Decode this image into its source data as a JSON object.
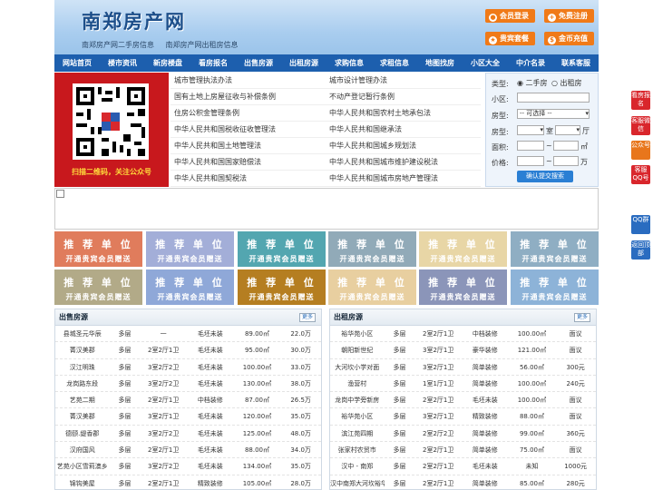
{
  "header": {
    "logo": "南郑房产网",
    "subtitle": [
      "南郑房产网二手房信息",
      "南郑房产网出租房信息"
    ],
    "buttons": [
      {
        "label": "会员登录",
        "icon": "user-icon"
      },
      {
        "label": "免费注册",
        "icon": "register-icon"
      },
      {
        "label": "贵宾套餐",
        "icon": "vip-icon"
      },
      {
        "label": "金币充值",
        "icon": "coin-icon"
      }
    ]
  },
  "nav": [
    "网站首页",
    "楼市资讯",
    "新房楼盘",
    "看房报名",
    "出售房源",
    "出租房源",
    "求购信息",
    "求租信息",
    "地图找房",
    "小区大全",
    "中介名录",
    "联系客服"
  ],
  "qr": {
    "caption": "扫描二维码，关注公众号"
  },
  "laws": [
    [
      "城市管理执法办法",
      "城市设计管理办法"
    ],
    [
      "国有土地上房屋征收与补偿条例",
      "不动产登记暂行条例"
    ],
    [
      "住房公积金管理条例",
      "中华人民共和国农村土地承包法"
    ],
    [
      "中华人民共和国税收征收管理法",
      "中华人民共和国继承法"
    ],
    [
      "中华人民共和国土地管理法",
      "中华人民共和国城乡规划法"
    ],
    [
      "中华人民共和国国家赔偿法",
      "中华人民共和国城市维护建设税法"
    ],
    [
      "中华人民共和国契税法",
      "中华人民共和国城市房地产管理法"
    ]
  ],
  "search": {
    "type_label": "类型:",
    "opt_sale": "二手房",
    "opt_rent": "出租房",
    "community_label": "小区:",
    "room_label": "房型:",
    "room_select": "-- 可选择 --",
    "shi": "室",
    "ting": "厅",
    "area_label": "面积:",
    "area_unit": "㎡",
    "price_label": "价格:",
    "price_unit": "万",
    "tilde": "~",
    "submit": "确认提交搜索"
  },
  "ads": {
    "line1": "推 荐 单 位",
    "line2": "开通贵宾会员赠送",
    "colors": [
      "#e07c5c",
      "#a3aed8",
      "#53a6b0",
      "#91aab8",
      "#e8d6a6",
      "#8faec3",
      "#b2aa88",
      "#8fa8d8",
      "#b57e21",
      "#e8cfa0",
      "#8b95b9",
      "#8db3d8"
    ]
  },
  "sale": {
    "title": "出售房源",
    "more": "更多",
    "rows": [
      [
        "县城圣元华辰",
        "多层",
        "一",
        "毛坯未装",
        "89.00㎡",
        "22.0万"
      ],
      [
        "菁汉美郡",
        "多层",
        "2室2厅1卫",
        "毛坯未装",
        "95.00㎡",
        "30.0万"
      ],
      [
        "汉江明珠",
        "多层",
        "3室2厅2卫",
        "毛坯未装",
        "100.00㎡",
        "33.0万"
      ],
      [
        "龙岗路东段",
        "多层",
        "3室2厅2卫",
        "毛坯未装",
        "130.00㎡",
        "38.0万"
      ],
      [
        "艺苑二期",
        "多层",
        "2室2厅1卫",
        "中档装修",
        "87.00㎡",
        "26.5万"
      ],
      [
        "菁汉美郡",
        "多层",
        "3室2厅1卫",
        "毛坯未装",
        "120.00㎡",
        "35.0万"
      ],
      [
        "德颐.缇香郡",
        "多层",
        "3室2厅2卫",
        "毛坯未装",
        "125.00㎡",
        "48.0万"
      ],
      [
        "汉府国风",
        "多层",
        "2室2厅1卫",
        "毛坯未装",
        "88.00㎡",
        "34.0万"
      ],
      [
        "艺苑小区雪莉澳乡",
        "多层",
        "3室2厅2卫",
        "毛坯未装",
        "134.00㎡",
        "35.0万"
      ],
      [
        "锦钩美屋",
        "多层",
        "2室2厅1卫",
        "精致装修",
        "105.00㎡",
        "28.0万"
      ]
    ]
  },
  "rent": {
    "title": "出租房源",
    "more": "更多",
    "rows": [
      [
        "裕华苑小区",
        "多层",
        "2室2厅1卫",
        "中档装修",
        "100.00㎡",
        "面议"
      ],
      [
        "朝阳新世纪",
        "多层",
        "3室2厅1卫",
        "豪华装修",
        "121.00㎡",
        "面议"
      ],
      [
        "大河坎小学对面",
        "多层",
        "3室2厅1卫",
        "简单装修",
        "56.00㎡",
        "300元"
      ],
      [
        "渔营村",
        "多层",
        "1室1厅1卫",
        "简单装修",
        "100.00㎡",
        "240元"
      ],
      [
        "龙岗中学旁新房",
        "多层",
        "2室2厅1卫",
        "毛坯未装",
        "100.00㎡",
        "面议"
      ],
      [
        "裕华苑小区",
        "多层",
        "3室2厅1卫",
        "精致装修",
        "88.00㎡",
        "面议"
      ],
      [
        "滨江苑四期",
        "多层",
        "2室2厅2卫",
        "简单装修",
        "99.00㎡",
        "360元"
      ],
      [
        "张家村农贸市",
        "多层",
        "2室2厅1卫",
        "简单装修",
        "75.00㎡",
        "面议"
      ],
      [
        "汉中 - 南郑",
        "多层",
        "2室2厅1卫",
        "毛坯未装",
        "未知",
        "1000元"
      ],
      [
        "汉中南郑大河坎裕华园",
        "多层",
        "2室2厅1卫",
        "简单装修",
        "85.00㎡",
        "280元"
      ]
    ]
  },
  "side": [
    {
      "label": "看房报名",
      "color": "#d9262c"
    },
    {
      "label": "客服微信",
      "color": "#d9262c"
    },
    {
      "label": "公众号",
      "color": "#e8761c"
    },
    {
      "label": "客服QQ号",
      "color": "#d9262c"
    },
    {
      "label": "QQ群",
      "color": "#2a6cc0"
    },
    {
      "label": "返回顶部",
      "color": "#2a6cc0"
    }
  ]
}
